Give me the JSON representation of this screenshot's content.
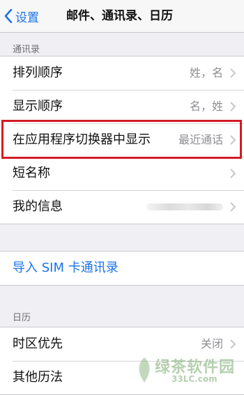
{
  "nav": {
    "back_label": "设置",
    "title": "邮件、通讯录、日历"
  },
  "contacts_section": {
    "header": "通讯录",
    "rows": [
      {
        "label": "排列顺序",
        "value": "姓，名"
      },
      {
        "label": "显示顺序",
        "value": "名，姓"
      },
      {
        "label": "在应用程序切换器中显示",
        "value": "最近通话"
      },
      {
        "label": "短名称",
        "value": ""
      },
      {
        "label": "我的信息",
        "value": ""
      }
    ]
  },
  "sim_import": {
    "label": "导入 SIM 卡通讯录"
  },
  "calendar_section": {
    "header": "日历",
    "rows": [
      {
        "label": "时区优先",
        "value": "关闭"
      },
      {
        "label": "其他历法",
        "value": ""
      }
    ]
  },
  "watermark": {
    "text": "绿茶软件园",
    "sub": "33LC.com"
  },
  "colors": {
    "accent": "#1a73e8",
    "highlight": "#d31b23",
    "background": "#efeff4"
  }
}
